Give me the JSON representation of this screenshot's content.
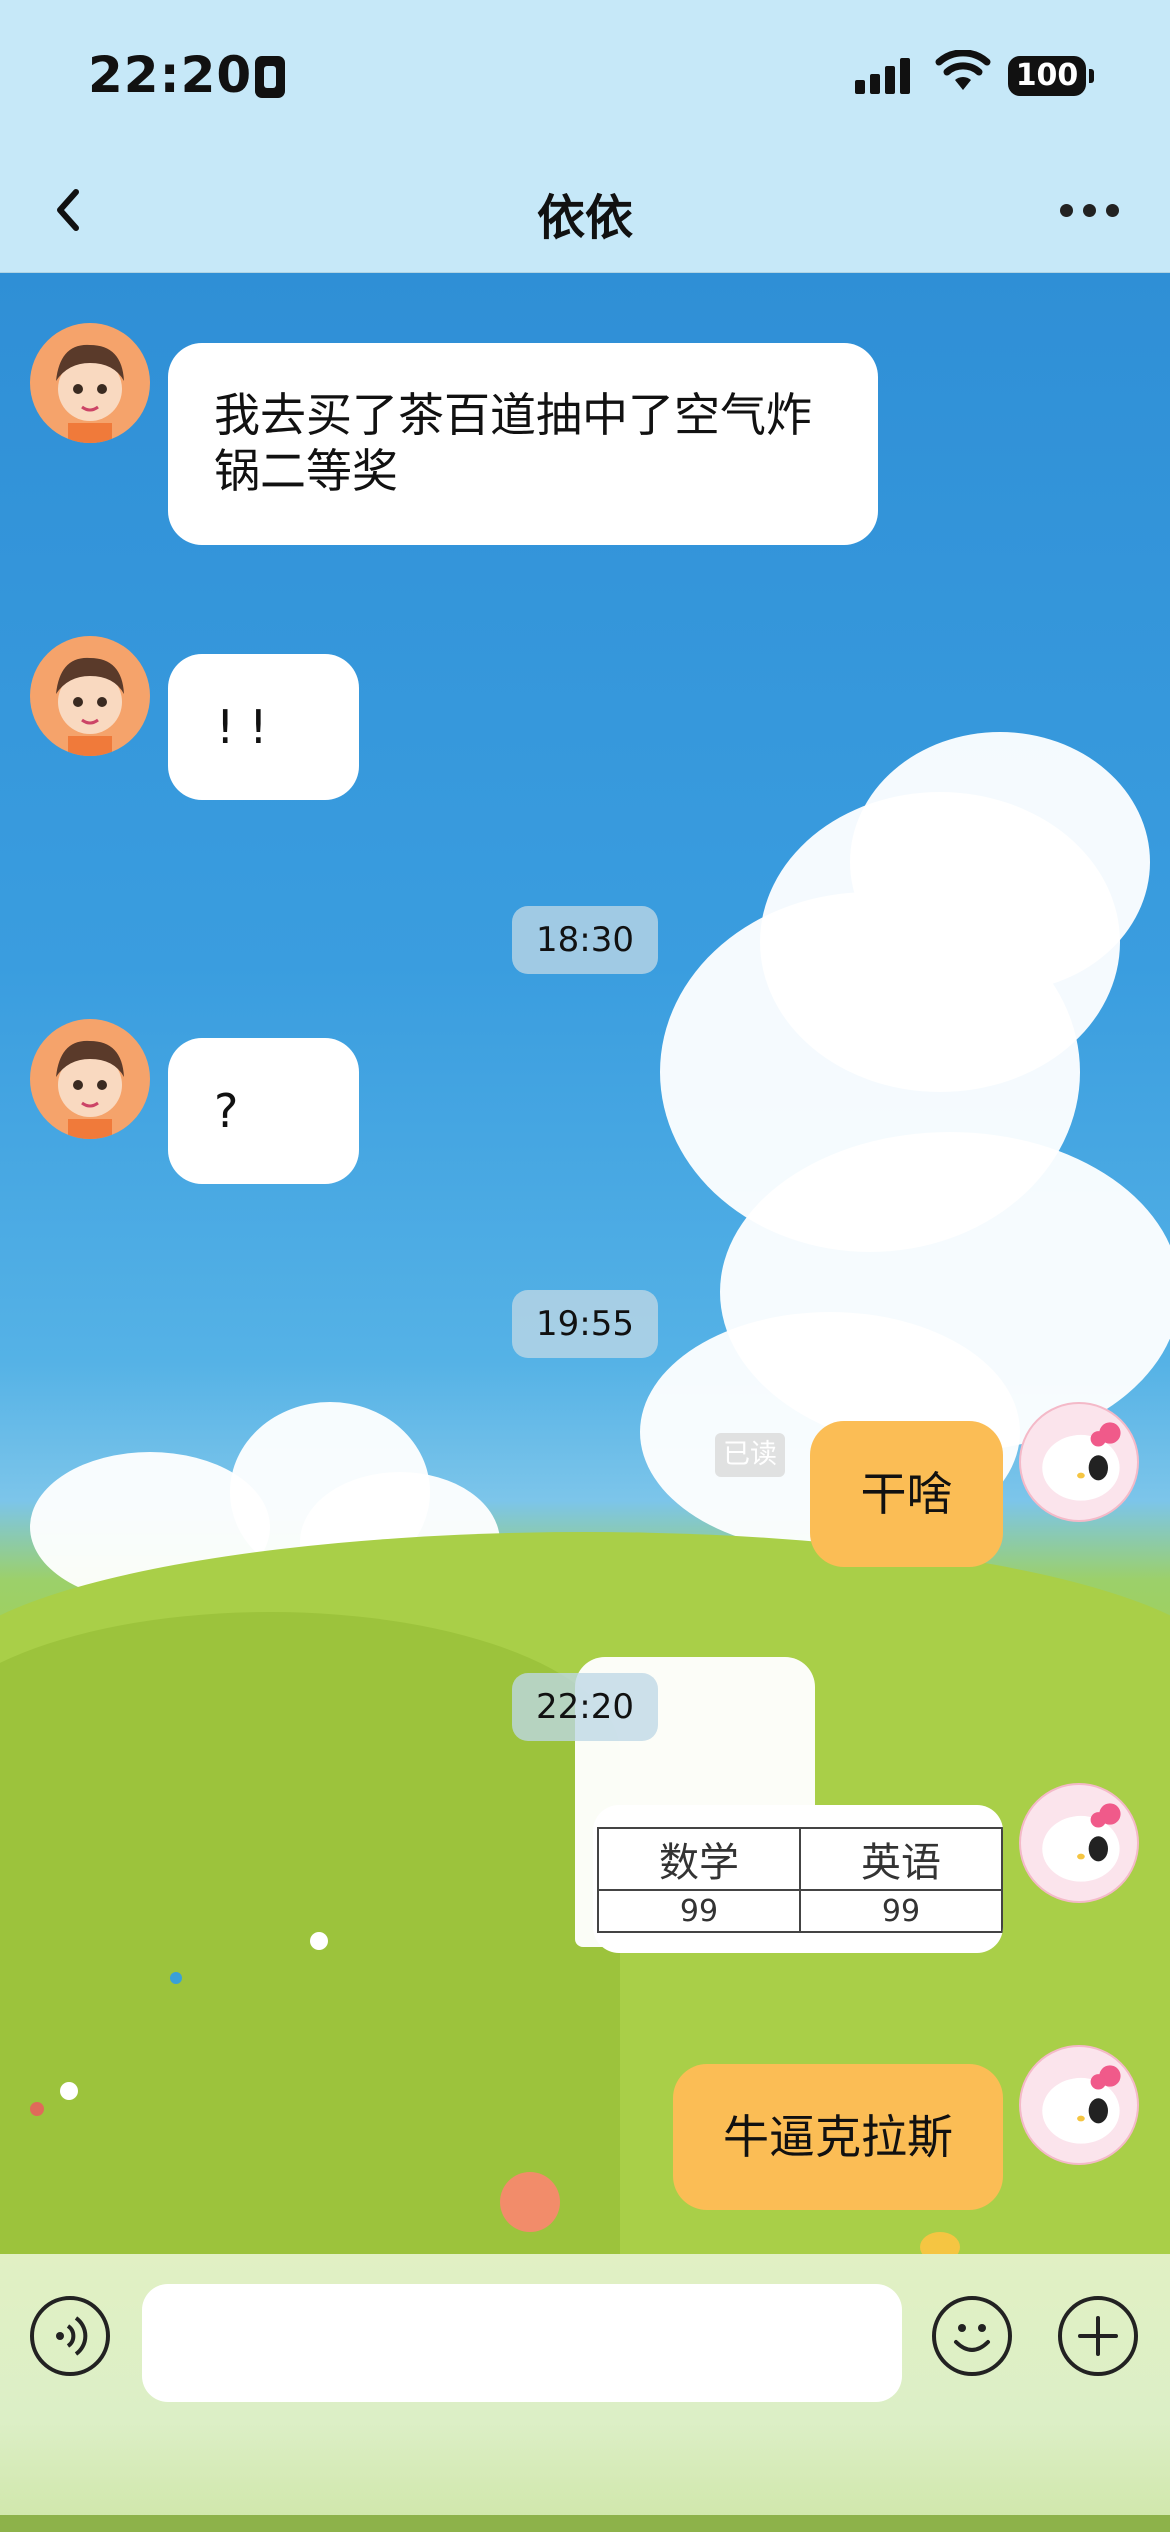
{
  "status_bar": {
    "time": "22:20",
    "battery": "100"
  },
  "nav": {
    "title": "依依"
  },
  "messages": [
    {
      "from": "other",
      "text": "我去买了茶百道抽中了空气炸锅二等奖"
    },
    {
      "from": "other",
      "text": "! !"
    },
    {
      "timestamp": "18:30"
    },
    {
      "from": "other",
      "text": "?"
    },
    {
      "timestamp": "19:55"
    },
    {
      "from": "me",
      "text": "干啥",
      "read_label": "已读"
    },
    {
      "timestamp": "22:20"
    },
    {
      "from": "me",
      "type": "image-table",
      "headers": [
        "数学",
        "英语"
      ],
      "values": [
        "99",
        "99"
      ]
    },
    {
      "from": "me",
      "text": "牛逼克拉斯"
    }
  ],
  "colors": {
    "my_bubble": "#fbbd55",
    "other_bubble": "#ffffff",
    "header_bg": "#c6e8f8"
  },
  "icons": {
    "back": "chevron-left-icon",
    "more": "more-horizontal-icon",
    "voice": "voice-icon",
    "emoji": "emoji-icon",
    "add": "plus-icon"
  }
}
